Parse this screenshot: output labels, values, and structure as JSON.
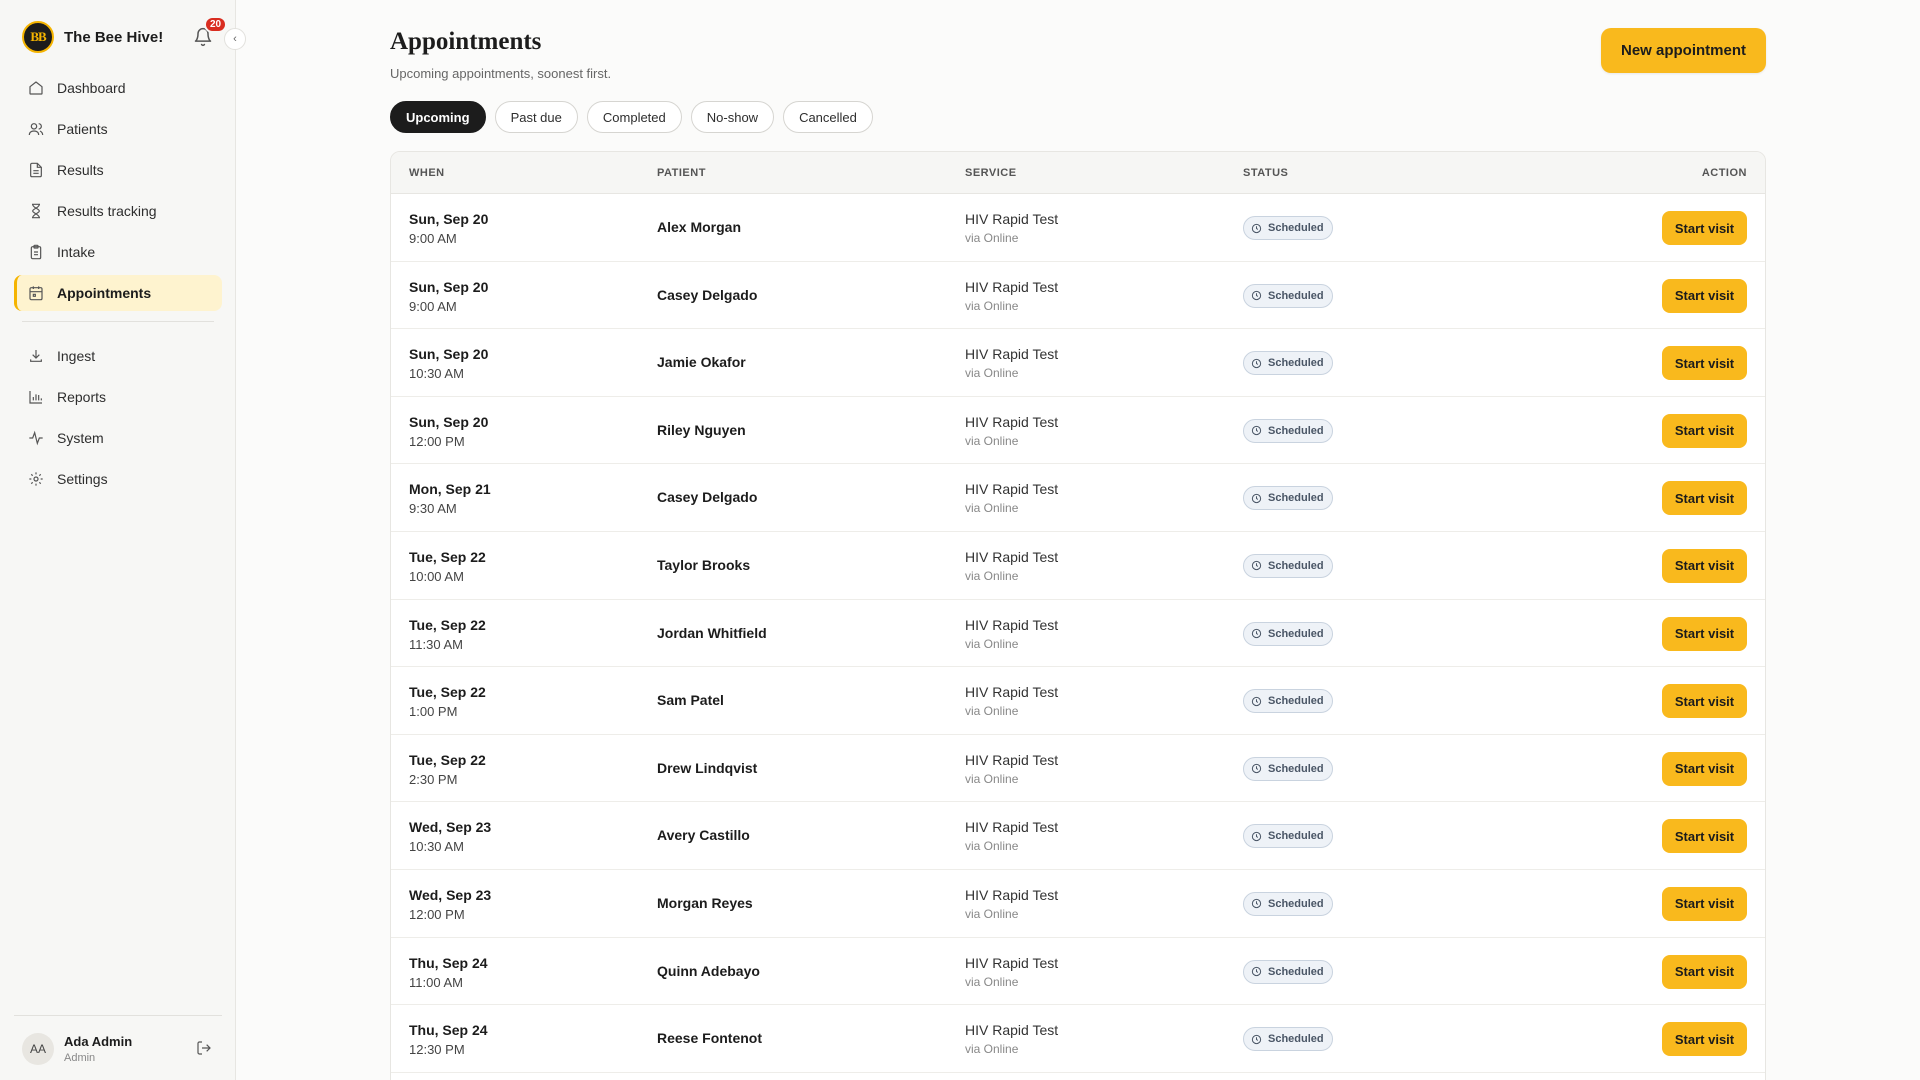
{
  "app": {
    "name": "The Bee Hive!",
    "logo_text": "BB",
    "notification_count": "20"
  },
  "sidebar": {
    "items": [
      {
        "label": "Dashboard",
        "icon": "home-icon"
      },
      {
        "label": "Patients",
        "icon": "users-icon"
      },
      {
        "label": "Results",
        "icon": "file-icon"
      },
      {
        "label": "Results tracking",
        "icon": "hourglass-icon"
      },
      {
        "label": "Intake",
        "icon": "clipboard-icon"
      },
      {
        "label": "Appointments",
        "icon": "calendar-icon",
        "active": true
      }
    ],
    "items2": [
      {
        "label": "Ingest",
        "icon": "download-icon"
      },
      {
        "label": "Reports",
        "icon": "bar-chart-icon"
      },
      {
        "label": "System",
        "icon": "activity-icon"
      },
      {
        "label": "Settings",
        "icon": "gear-icon"
      }
    ]
  },
  "user": {
    "initials": "AA",
    "name": "Ada Admin",
    "role": "Admin"
  },
  "page": {
    "title": "Appointments",
    "subtitle": "Upcoming appointments, soonest first.",
    "new_button": "New appointment"
  },
  "tabs": [
    "Upcoming",
    "Past due",
    "Completed",
    "No-show",
    "Cancelled"
  ],
  "table": {
    "headers": {
      "when": "WHEN",
      "patient": "PATIENT",
      "service": "SERVICE",
      "status": "STATUS",
      "action": "ACTION"
    },
    "rows": [
      {
        "date": "Sun, Sep 20",
        "time": "9:00 AM",
        "patient": "Alex Morgan",
        "service": "HIV Rapid Test",
        "via": "via Online",
        "status": "Scheduled",
        "action": "Start visit"
      },
      {
        "date": "Sun, Sep 20",
        "time": "9:00 AM",
        "patient": "Casey Delgado",
        "service": "HIV Rapid Test",
        "via": "via Online",
        "status": "Scheduled",
        "action": "Start visit"
      },
      {
        "date": "Sun, Sep 20",
        "time": "10:30 AM",
        "patient": "Jamie Okafor",
        "service": "HIV Rapid Test",
        "via": "via Online",
        "status": "Scheduled",
        "action": "Start visit"
      },
      {
        "date": "Sun, Sep 20",
        "time": "12:00 PM",
        "patient": "Riley Nguyen",
        "service": "HIV Rapid Test",
        "via": "via Online",
        "status": "Scheduled",
        "action": "Start visit"
      },
      {
        "date": "Mon, Sep 21",
        "time": "9:30 AM",
        "patient": "Casey Delgado",
        "service": "HIV Rapid Test",
        "via": "via Online",
        "status": "Scheduled",
        "action": "Start visit"
      },
      {
        "date": "Tue, Sep 22",
        "time": "10:00 AM",
        "patient": "Taylor Brooks",
        "service": "HIV Rapid Test",
        "via": "via Online",
        "status": "Scheduled",
        "action": "Start visit"
      },
      {
        "date": "Tue, Sep 22",
        "time": "11:30 AM",
        "patient": "Jordan Whitfield",
        "service": "HIV Rapid Test",
        "via": "via Online",
        "status": "Scheduled",
        "action": "Start visit"
      },
      {
        "date": "Tue, Sep 22",
        "time": "1:00 PM",
        "patient": "Sam Patel",
        "service": "HIV Rapid Test",
        "via": "via Online",
        "status": "Scheduled",
        "action": "Start visit"
      },
      {
        "date": "Tue, Sep 22",
        "time": "2:30 PM",
        "patient": "Drew Lindqvist",
        "service": "HIV Rapid Test",
        "via": "via Online",
        "status": "Scheduled",
        "action": "Start visit"
      },
      {
        "date": "Wed, Sep 23",
        "time": "10:30 AM",
        "patient": "Avery Castillo",
        "service": "HIV Rapid Test",
        "via": "via Online",
        "status": "Scheduled",
        "action": "Start visit"
      },
      {
        "date": "Wed, Sep 23",
        "time": "12:00 PM",
        "patient": "Morgan Reyes",
        "service": "HIV Rapid Test",
        "via": "via Online",
        "status": "Scheduled",
        "action": "Start visit"
      },
      {
        "date": "Thu, Sep 24",
        "time": "11:00 AM",
        "patient": "Quinn Adebayo",
        "service": "HIV Rapid Test",
        "via": "via Online",
        "status": "Scheduled",
        "action": "Start visit"
      },
      {
        "date": "Thu, Sep 24",
        "time": "12:30 PM",
        "patient": "Reese Fontenot",
        "service": "HIV Rapid Test",
        "via": "via Online",
        "status": "Scheduled",
        "action": "Start visit"
      }
    ]
  },
  "colors": {
    "accent": "#f9b91d",
    "active_bg": "#fef3cf",
    "badge": "#d92d20",
    "dark": "#1c1c1c"
  }
}
